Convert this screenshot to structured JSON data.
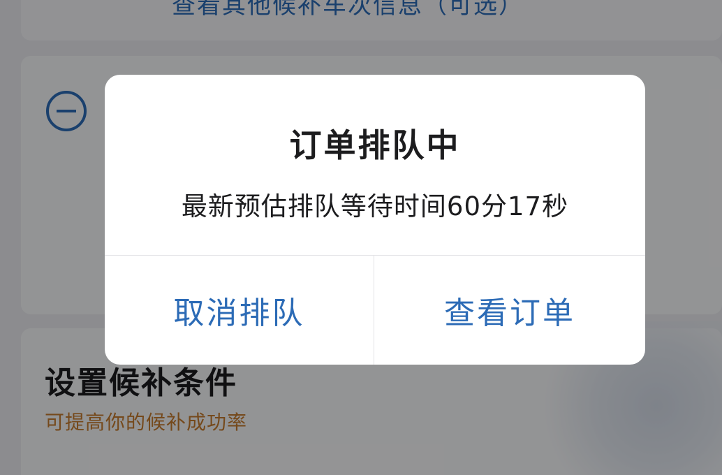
{
  "background": {
    "top_link_text": "查看其他候补车次信息（可选）",
    "section_title": "设置候补条件",
    "section_subtitle": "可提高你的候补成功率"
  },
  "dialog": {
    "title": "订单排队中",
    "message": "最新预估排队等待时间60分17秒",
    "cancel_label": "取消排队",
    "view_label": "查看订单"
  },
  "colors": {
    "accent": "#2c6bb6",
    "subtitle": "#c47a2e",
    "text": "#1c1c1e"
  }
}
